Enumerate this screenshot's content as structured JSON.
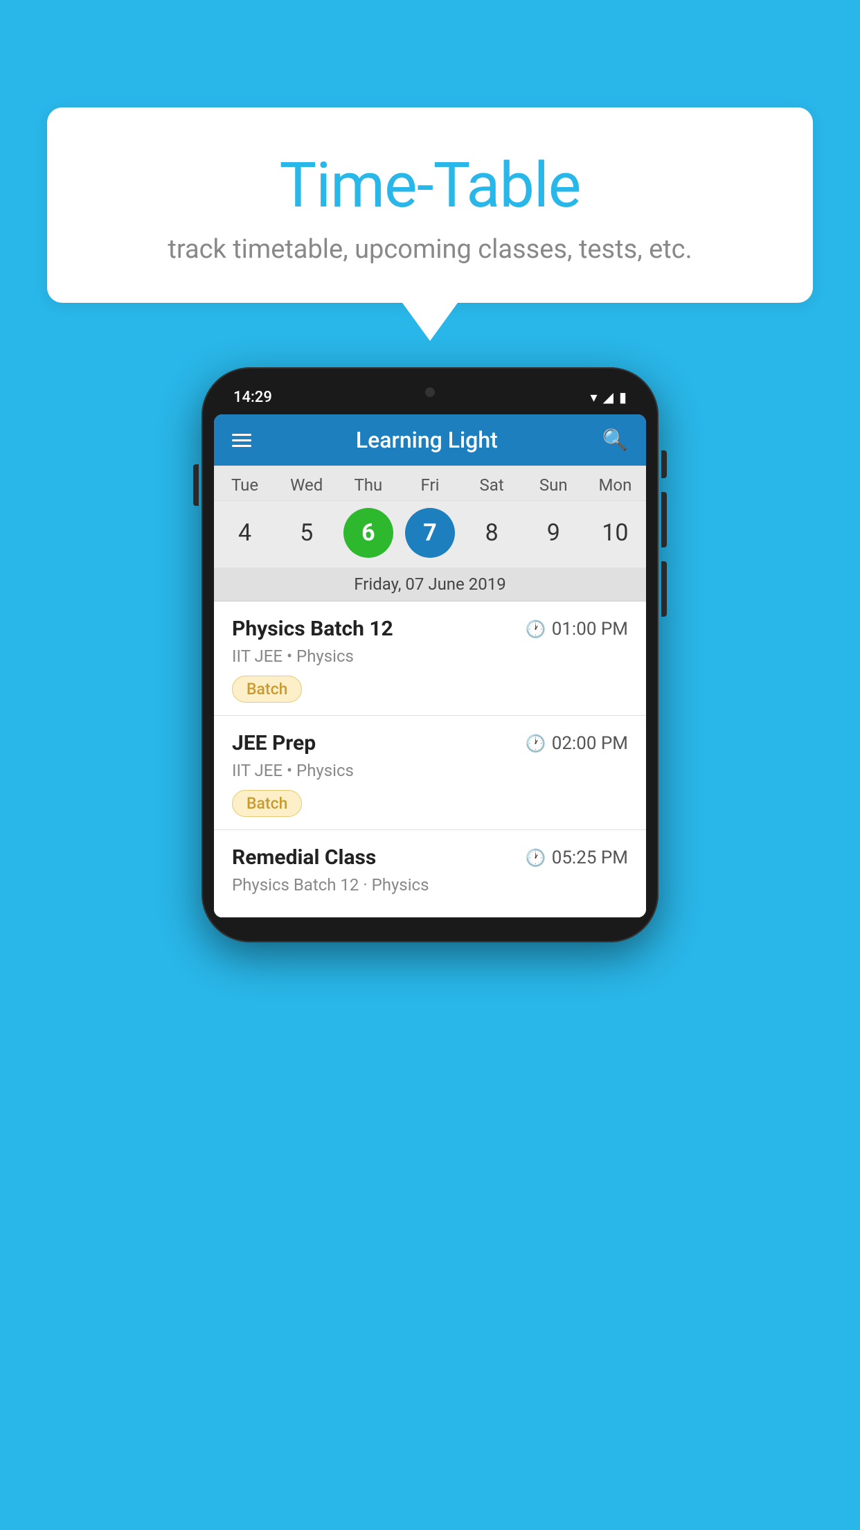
{
  "background": {
    "color": "#29b6e8"
  },
  "speech_bubble": {
    "title": "Time-Table",
    "subtitle": "track timetable, upcoming classes, tests, etc."
  },
  "phone": {
    "time": "14:29",
    "app_name": "Learning Light",
    "calendar": {
      "days": [
        "Tue",
        "Wed",
        "Thu",
        "Fri",
        "Sat",
        "Sun",
        "Mon"
      ],
      "dates": [
        "4",
        "5",
        "6",
        "7",
        "8",
        "9",
        "10"
      ],
      "today_index": 2,
      "selected_index": 3,
      "selected_date_label": "Friday, 07 June 2019"
    },
    "classes": [
      {
        "name": "Physics Batch 12",
        "time": "01:00 PM",
        "subtitle": "IIT JEE • Physics",
        "badge": "Batch"
      },
      {
        "name": "JEE Prep",
        "time": "02:00 PM",
        "subtitle": "IIT JEE • Physics",
        "badge": "Batch"
      },
      {
        "name": "Remedial Class",
        "time": "05:25 PM",
        "subtitle": "Physics Batch 12 · Physics",
        "badge": null
      }
    ]
  }
}
